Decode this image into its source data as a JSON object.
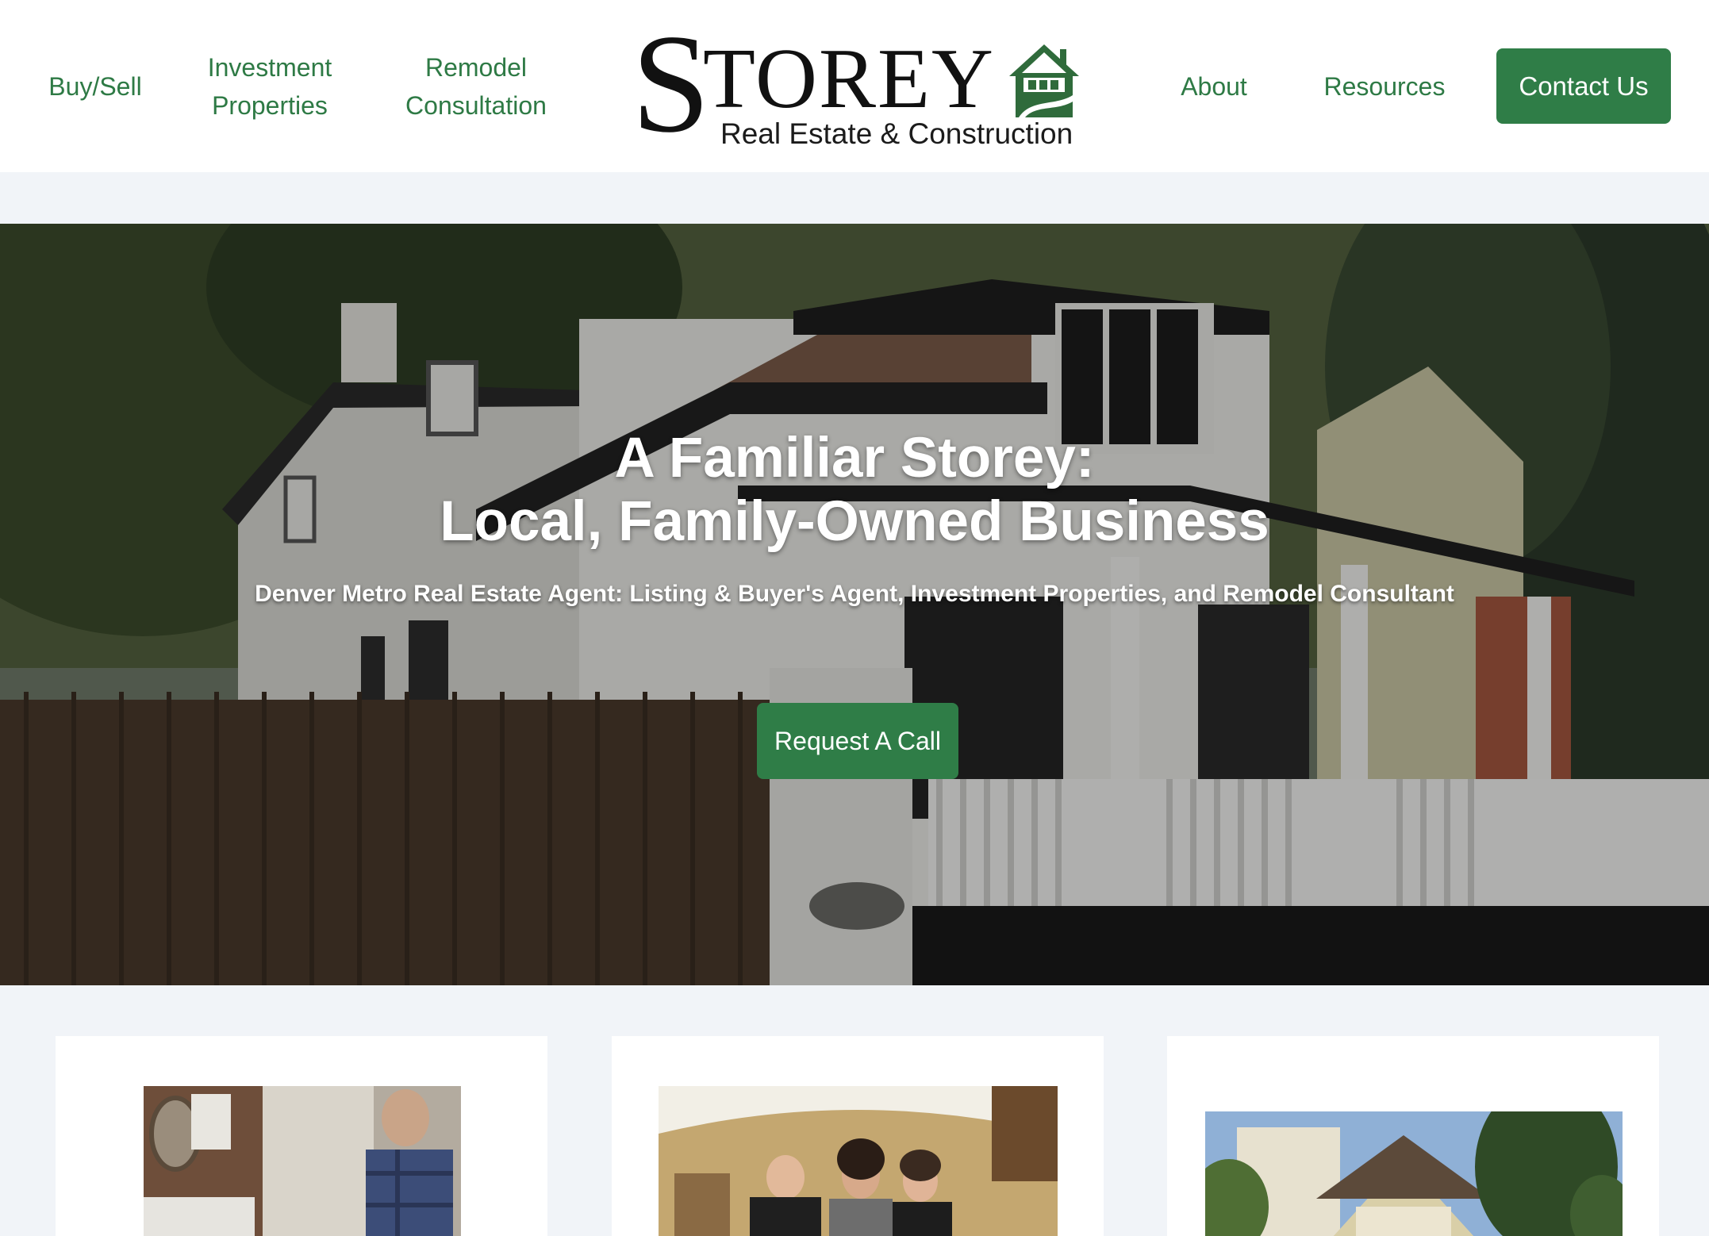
{
  "nav": {
    "buy_sell": "Buy/Sell",
    "investment_line1": "Investment",
    "investment_line2": "Properties",
    "remodel_line1": "Remodel",
    "remodel_line2": "Consultation",
    "about": "About",
    "resources": "Resources",
    "contact": "Contact Us"
  },
  "logo": {
    "initial": "S",
    "rest": "TOREY",
    "tagline": "Real Estate & Construction"
  },
  "hero": {
    "title_line1": "A Familiar Storey:",
    "title_line2": "Local, Family-Owned Business",
    "subtitle": "Denver Metro Real Estate Agent: Listing & Buyer's Agent, Investment Properties, and Remodel Consultant",
    "cta": "Request A Call"
  },
  "colors": {
    "brand_green": "#2f7d47",
    "nav_text": "#2e7a45",
    "page_bg": "#f1f4f8"
  },
  "icons": {
    "logo_house": "house-icon"
  }
}
